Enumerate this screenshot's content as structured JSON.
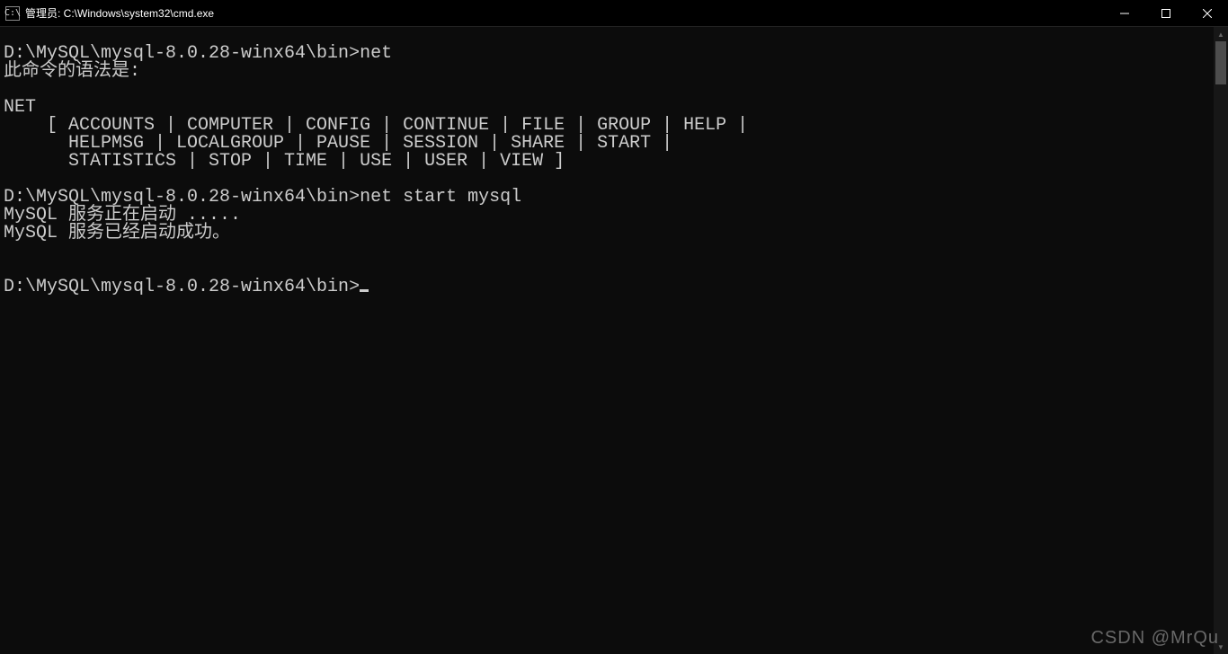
{
  "titlebar": {
    "icon_label": "C:\\",
    "title": "管理员: C:\\Windows\\system32\\cmd.exe"
  },
  "terminal": {
    "blank_top": "",
    "line1_prompt": "D:\\MySQL\\mysql-8.0.28-winx64\\bin>",
    "line1_cmd": "net",
    "line2": "此命令的语法是:",
    "blank1": "",
    "line3": "NET",
    "line4": "    [ ACCOUNTS | COMPUTER | CONFIG | CONTINUE | FILE | GROUP | HELP |",
    "line5": "      HELPMSG | LOCALGROUP | PAUSE | SESSION | SHARE | START |",
    "line6": "      STATISTICS | STOP | TIME | USE | USER | VIEW ]",
    "blank2": "",
    "line7_prompt": "D:\\MySQL\\mysql-8.0.28-winx64\\bin>",
    "line7_cmd": "net start mysql",
    "line8": "MySQL 服务正在启动 .....",
    "line9": "MySQL 服务已经启动成功。",
    "blank3": "",
    "blank4": "",
    "line10_prompt": "D:\\MySQL\\mysql-8.0.28-winx64\\bin>"
  },
  "watermark": "CSDN @MrQu"
}
